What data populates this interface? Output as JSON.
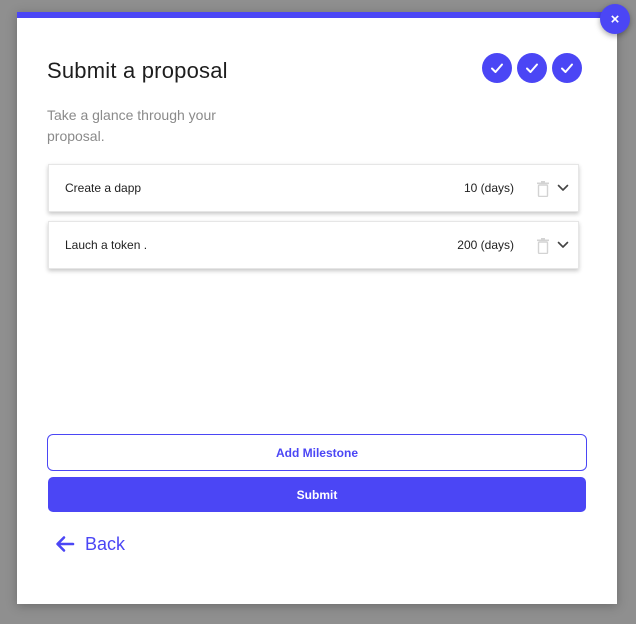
{
  "modal": {
    "close_label": "×",
    "title": "Submit a proposal",
    "subtitle": "Take a glance through your proposal.",
    "steps": [
      {
        "status": "complete",
        "icon": "check-icon"
      },
      {
        "status": "complete",
        "icon": "check-icon"
      },
      {
        "status": "complete",
        "icon": "check-icon"
      }
    ],
    "milestones": [
      {
        "title": "Create a dapp",
        "duration": "10 (days)"
      },
      {
        "title": "Lauch a token .",
        "duration": "200 (days)"
      }
    ],
    "add_milestone_label": "Add Milestone",
    "submit_label": "Submit",
    "back_label": "Back"
  },
  "colors": {
    "accent": "#4b46f5",
    "overlay": "#8f8f8f",
    "text": "#1e1e1e",
    "muted": "#8a8a8a"
  }
}
